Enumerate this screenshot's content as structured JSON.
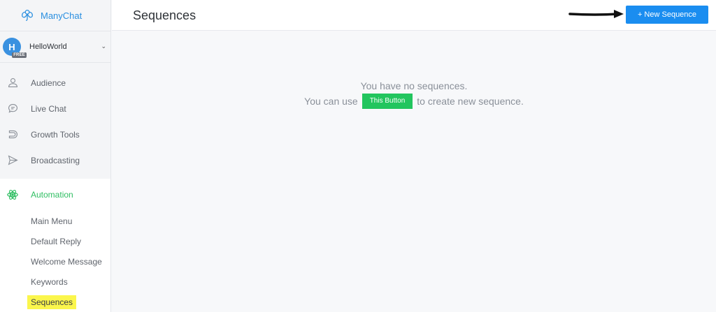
{
  "brand": {
    "name": "ManyChat",
    "color": "#2a8fe0"
  },
  "account": {
    "initial": "H",
    "badge": "FREE",
    "name": "HelloWorld"
  },
  "nav": [
    {
      "label": "Audience",
      "icon": "user-icon"
    },
    {
      "label": "Live Chat",
      "icon": "chat-bubble-icon"
    },
    {
      "label": "Growth Tools",
      "icon": "magnet-icon"
    },
    {
      "label": "Broadcasting",
      "icon": "send-icon"
    }
  ],
  "automation": {
    "label": "Automation",
    "icon": "atom-icon",
    "items": [
      "Main Menu",
      "Default Reply",
      "Welcome Message",
      "Keywords",
      "Sequences"
    ]
  },
  "header": {
    "title": "Sequences",
    "new_button": "+ New Sequence"
  },
  "empty_state": {
    "line1": "You have no sequences.",
    "line2_prefix": "You can use",
    "button_label": "This Button",
    "line2_suffix": "to create new sequence."
  },
  "colors": {
    "primary": "#1a8df0",
    "success": "#22c55e",
    "highlight": "#fbf64c"
  }
}
